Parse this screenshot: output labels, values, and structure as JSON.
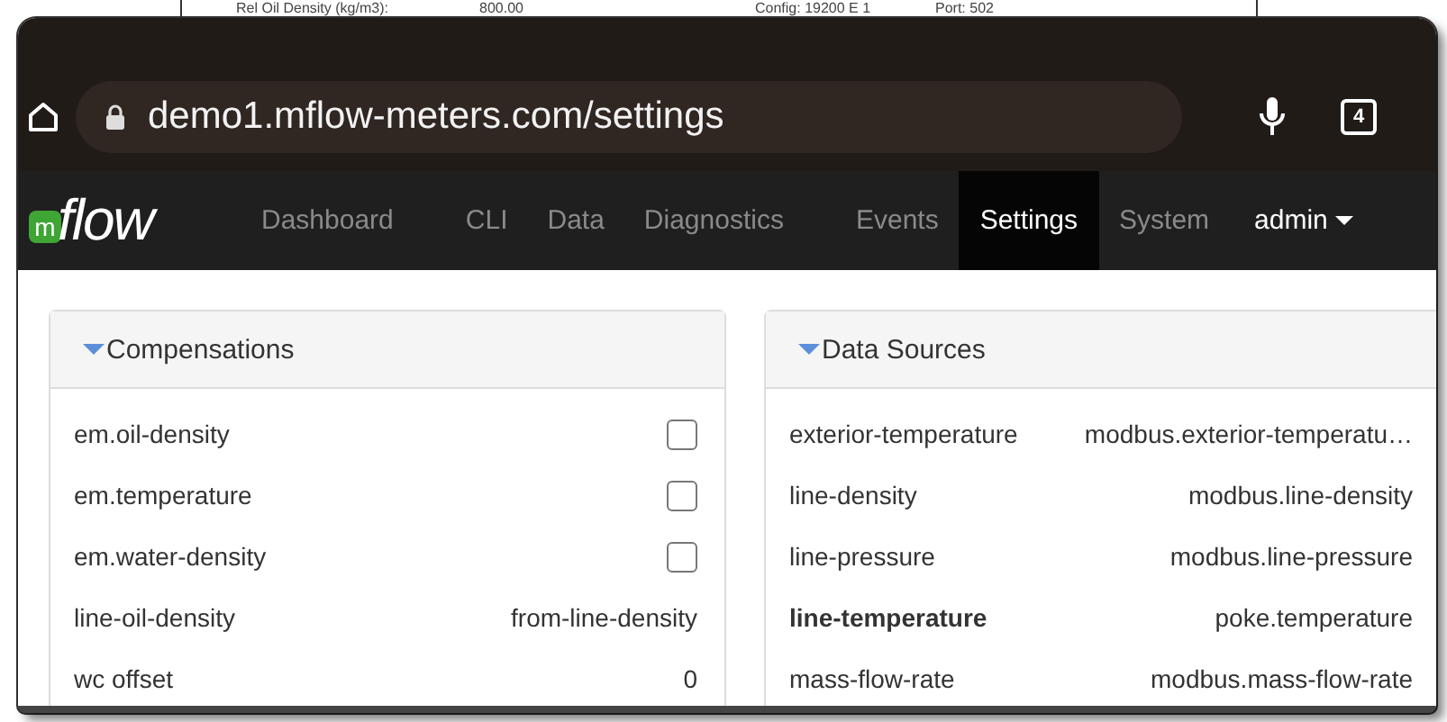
{
  "background_page": {
    "texts": [
      "Rel Oil Density (kg/m3):",
      "800.00",
      "Config: 19200 E 1",
      "Port: 502"
    ]
  },
  "browser": {
    "url": "demo1.mflow-meters.com/settings",
    "tab_count": "4"
  },
  "logo": {
    "badge": "m",
    "text": "flow"
  },
  "nav": {
    "items": [
      {
        "label": "Dashboard",
        "selected": false
      },
      {
        "label": "CLI",
        "selected": false
      },
      {
        "label": "Data",
        "selected": false
      },
      {
        "label": "Diagnostics",
        "selected": false
      },
      {
        "label": "Events",
        "selected": false
      },
      {
        "label": "Settings",
        "selected": true
      },
      {
        "label": "System",
        "selected": false
      }
    ],
    "user": "admin"
  },
  "panels": [
    {
      "title": "Compensations",
      "expanded": true,
      "rows": [
        {
          "label": "em.oil-density",
          "kind": "checkbox",
          "checked": false
        },
        {
          "label": "em.temperature",
          "kind": "checkbox",
          "checked": false
        },
        {
          "label": "em.water-density",
          "kind": "checkbox",
          "checked": false
        },
        {
          "label": "line-oil-density",
          "kind": "text",
          "value": "from-line-density"
        },
        {
          "label": "wc offset",
          "kind": "text",
          "value": "0"
        }
      ]
    },
    {
      "title": "Data Sources",
      "expanded": true,
      "rows": [
        {
          "label": "exterior-temperature",
          "kind": "text",
          "value": "modbus.exterior-temperatu…",
          "bold": false
        },
        {
          "label": "line-density",
          "kind": "text",
          "value": "modbus.line-density",
          "bold": false
        },
        {
          "label": "line-pressure",
          "kind": "text",
          "value": "modbus.line-pressure",
          "bold": false
        },
        {
          "label": "line-temperature",
          "kind": "text",
          "value": "poke.temperature",
          "bold": true
        },
        {
          "label": "mass-flow-rate",
          "kind": "text",
          "value": "modbus.mass-flow-rate",
          "bold": false
        }
      ]
    }
  ]
}
